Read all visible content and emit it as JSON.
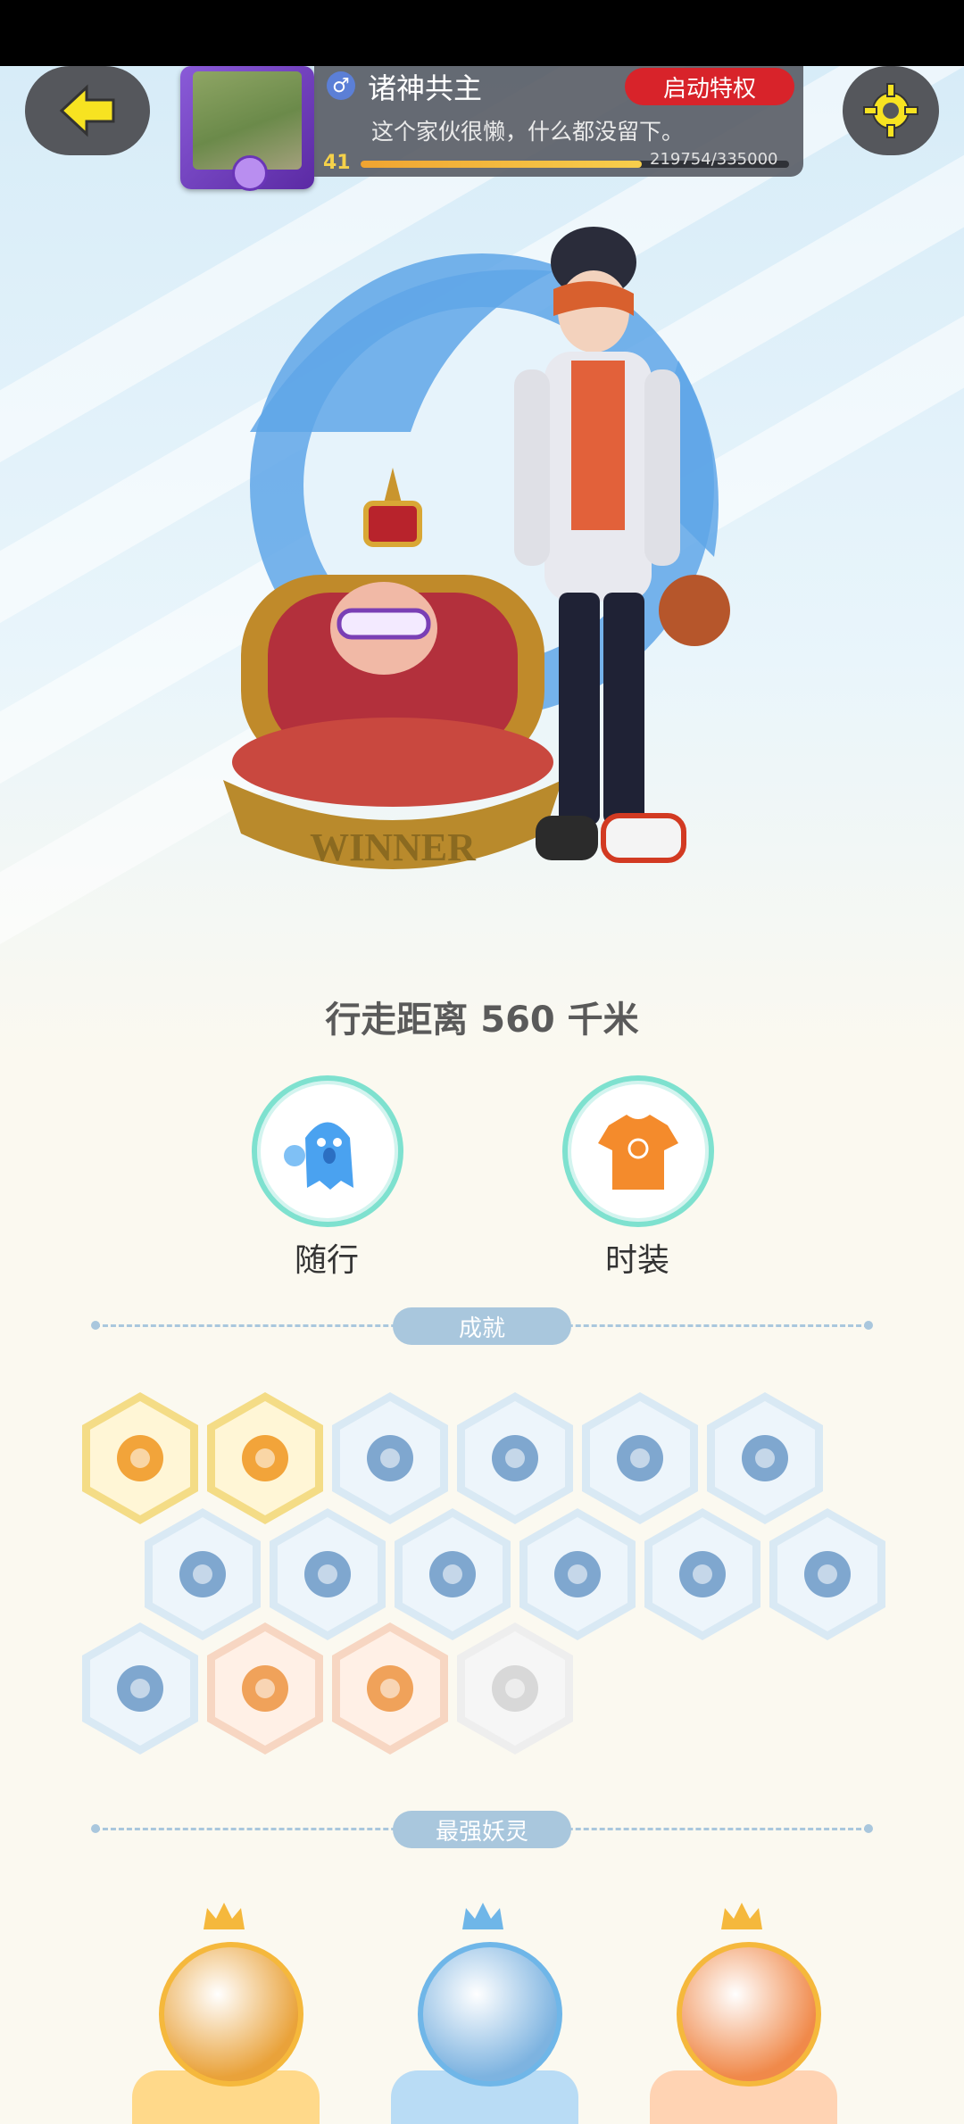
{
  "header": {
    "username": "诸神共主",
    "gender_symbol": "♂",
    "privilege_button": "启动特权",
    "bio": "这个家伙很懒，什么都没留下。",
    "level": "41",
    "xp_text": "219754/335000",
    "xp_progress": 0.656
  },
  "stats": {
    "walk_distance": "行走距离 560 千米"
  },
  "quick_actions": [
    {
      "label": "随行",
      "icon": "companion-ghost-icon"
    },
    {
      "label": "时装",
      "icon": "tshirt-icon"
    }
  ],
  "sections": {
    "achievements_title": "成就",
    "strongest_spirits_title": "最强妖灵"
  },
  "achievements": [
    {
      "icon": "fox-face-icon",
      "style": "gold"
    },
    {
      "icon": "gold-orb-icon",
      "style": "gold"
    },
    {
      "icon": "sneaker-icon",
      "style": "blue"
    },
    {
      "icon": "radar-icon",
      "style": "blue"
    },
    {
      "icon": "moon-icon",
      "style": "blue"
    },
    {
      "icon": "crystal-icon",
      "style": "blue"
    },
    {
      "icon": "yin-yang-wave-icon",
      "style": "blue"
    },
    {
      "icon": "spirit-pose-icon",
      "style": "blue"
    },
    {
      "icon": "cat-wand-icon",
      "style": "blue"
    },
    {
      "icon": "taiji-cube-icon",
      "style": "blue"
    },
    {
      "icon": "scroll-icon",
      "style": "blue"
    },
    {
      "icon": "creature-icon",
      "style": "blue"
    },
    {
      "icon": "book-fox-icon",
      "style": "blue"
    },
    {
      "icon": "cart-cat-icon",
      "style": "orange"
    },
    {
      "icon": "horned-spirit-icon",
      "style": "orange"
    },
    {
      "icon": "locked-statue-icon",
      "style": "grey"
    }
  ],
  "spirits": [
    {
      "name": "dark-phoenix",
      "crown_color": "#f5b83c",
      "base_color": "#ffd98a"
    },
    {
      "name": "silver-hair-girl",
      "crown_color": "#6fb6e8",
      "base_color": "#b9dcf5"
    },
    {
      "name": "green-forest-spirit",
      "crown_color": "#f5b83c",
      "base_color": "#ffd3b3"
    }
  ]
}
